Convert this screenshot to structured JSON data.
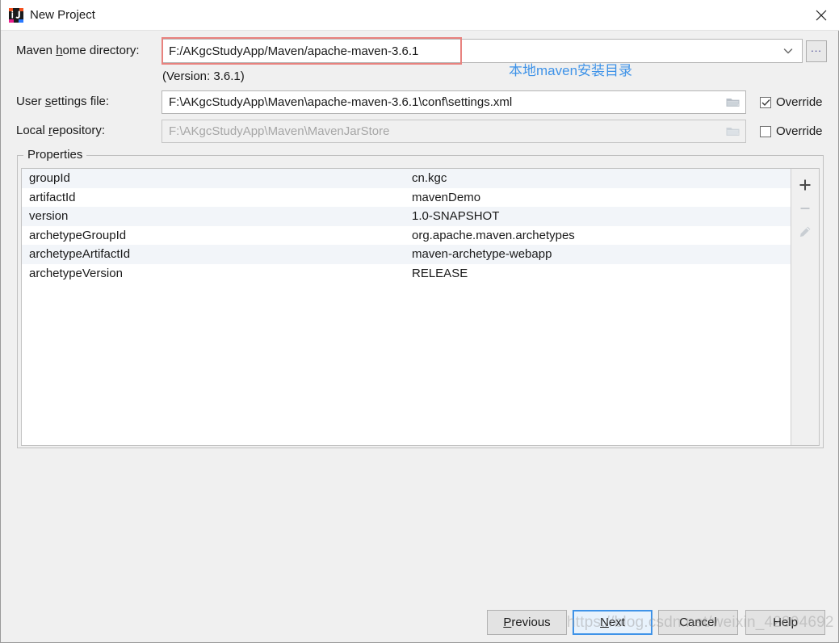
{
  "window": {
    "title": "New Project",
    "icon": "intellij-idea-icon",
    "close_label": "×"
  },
  "form": {
    "maven_home": {
      "label_pre": "Maven ",
      "label_mnemonic": "h",
      "label_post": "ome directory:",
      "value": "F:/AKgcStudyApp/Maven/apache-maven-3.6.1",
      "version_note": "(Version: 3.6.1)",
      "browse_label": "...",
      "dropdown_icon": "chevron-down-icon",
      "highlight_color": "#e8827e"
    },
    "annotation": {
      "text": "本地maven安装目录",
      "color": "#3f93e8"
    },
    "user_settings": {
      "label_pre": "User ",
      "label_mnemonic": "s",
      "label_post": "ettings file:",
      "value": "F:\\AKgcStudyApp\\Maven\\apache-maven-3.6.1\\conf\\settings.xml",
      "folder_icon": "folder-icon",
      "override_label": "Override",
      "override_checked": true,
      "disabled": false
    },
    "local_repository": {
      "label_pre": "Local ",
      "label_mnemonic": "r",
      "label_post": "epository:",
      "value": "F:\\AKgcStudyApp\\Maven\\MavenJarStore",
      "folder_icon": "folder-icon",
      "override_label": "Override",
      "override_checked": false,
      "disabled": true
    }
  },
  "properties": {
    "legend": "Properties",
    "rows": [
      {
        "key": "groupId",
        "value": "cn.kgc"
      },
      {
        "key": "artifactId",
        "value": "mavenDemo"
      },
      {
        "key": "version",
        "value": "1.0-SNAPSHOT"
      },
      {
        "key": "archetypeGroupId",
        "value": "org.apache.maven.archetypes"
      },
      {
        "key": "archetypeArtifactId",
        "value": "maven-archetype-webapp"
      },
      {
        "key": "archetypeVersion",
        "value": "RELEASE"
      }
    ],
    "toolbar": {
      "add_icon": "plus-icon",
      "add_enabled": true,
      "remove_icon": "minus-icon",
      "remove_enabled": false,
      "edit_icon": "pencil-icon",
      "edit_enabled": false
    }
  },
  "buttons": {
    "previous": {
      "pre": "",
      "mnemonic": "P",
      "post": "revious",
      "default": false
    },
    "next": {
      "pre": "",
      "mnemonic": "N",
      "post": "ext",
      "default": true
    },
    "cancel": {
      "pre": "Cancel",
      "mnemonic": "",
      "post": "",
      "default": false
    },
    "help": {
      "pre": "Help",
      "mnemonic": "",
      "post": "",
      "default": false
    }
  },
  "watermark": {
    "text": "https://blog.csdn.net/weixin_42804692"
  }
}
